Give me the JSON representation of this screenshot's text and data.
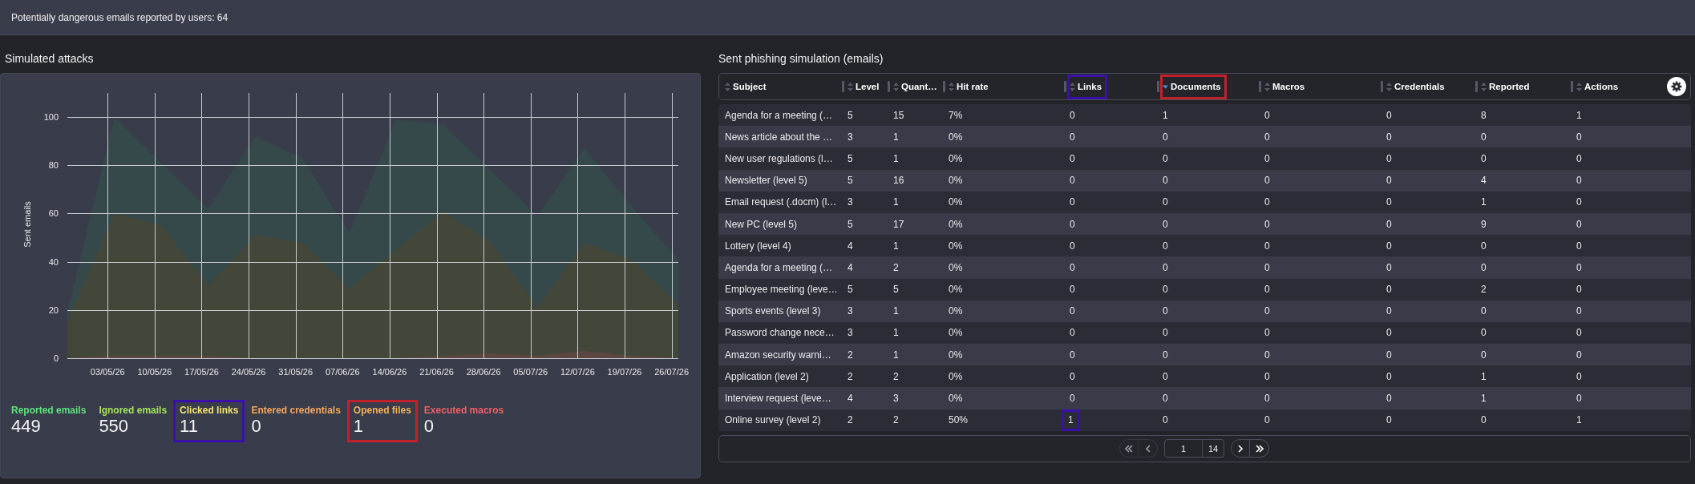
{
  "top_bar": {
    "text": "Potentially dangerous emails reported by users: 64"
  },
  "simulated_attacks": {
    "title": "Simulated attacks",
    "chart_data": {
      "type": "area",
      "ylabel": "Sent emails",
      "grid": true,
      "categories": [
        null,
        "03/05/26",
        "10/05/26",
        "17/05/26",
        "24/05/26",
        "31/05/26",
        "07/06/26",
        "14/06/26",
        "21/06/26",
        "28/06/26",
        "05/07/26",
        "12/07/26",
        "19/07/26",
        "26/07/26"
      ],
      "ylim": [
        0,
        110
      ],
      "yticks": [
        0,
        20,
        40,
        60,
        80,
        100
      ],
      "series": [
        {
          "color": "#35494a",
          "values": [
            19,
            100,
            81,
            62,
            92,
            83,
            52,
            99,
            97,
            78,
            59,
            87,
            63,
            41
          ]
        },
        {
          "color": "#434739",
          "values": [
            15,
            60,
            55,
            30,
            51,
            48,
            29,
            45,
            61,
            48,
            21,
            48,
            41,
            22
          ]
        },
        {
          "color": "#5b4641",
          "values": [
            0,
            1,
            1,
            1,
            0,
            0,
            0,
            0,
            1,
            2,
            1,
            3,
            1,
            0
          ]
        }
      ]
    },
    "stats": [
      {
        "label": "Reported emails",
        "value": "449",
        "color": "#5ee27f"
      },
      {
        "label": "Ignored emails",
        "value": "550",
        "color": "#a2e35b"
      },
      {
        "label": "Clicked links",
        "value": "11",
        "color": "#f3e36b",
        "highlight": {
          "color": "#3b10a8"
        }
      },
      {
        "label": "Entered credentials",
        "value": "0",
        "color": "#f6a75e"
      },
      {
        "label": "Opened files",
        "value": "1",
        "color": "#f4b257",
        "highlight": {
          "color": "#c2212a"
        }
      },
      {
        "label": "Executed macros",
        "value": "0",
        "color": "#f25f66"
      }
    ]
  },
  "phishing_table": {
    "title": "Sent phishing simulation (emails)",
    "columns": [
      {
        "label": "Subject",
        "sorted": false
      },
      {
        "label": "Level",
        "sorted": false
      },
      {
        "label": "Quant…",
        "sorted": false
      },
      {
        "label": "Hit rate",
        "sorted": false
      },
      {
        "label": "Links",
        "sorted": false,
        "highlight": {
          "color": "#3b10a8"
        }
      },
      {
        "label": "Documents",
        "sorted": true,
        "highlight": {
          "color": "#c2212a"
        }
      },
      {
        "label": "Macros",
        "sorted": false
      },
      {
        "label": "Credentials",
        "sorted": false
      },
      {
        "label": "Reported",
        "sorted": false
      },
      {
        "label": "Actions",
        "sorted": false
      }
    ],
    "rows": [
      {
        "cells": [
          "Agenda for a meeting (…",
          "5",
          "15",
          "7%",
          "0",
          "1",
          "0",
          "0",
          "8",
          "1"
        ]
      },
      {
        "cells": [
          "News article about the …",
          "3",
          "1",
          "0%",
          "0",
          "0",
          "0",
          "0",
          "0",
          "0"
        ]
      },
      {
        "cells": [
          "New user regulations (l…",
          "5",
          "1",
          "0%",
          "0",
          "0",
          "0",
          "0",
          "0",
          "0"
        ]
      },
      {
        "cells": [
          "Newsletter (level 5)",
          "5",
          "16",
          "0%",
          "0",
          "0",
          "0",
          "0",
          "4",
          "0"
        ]
      },
      {
        "cells": [
          "Email request (.docm) (l…",
          "3",
          "1",
          "0%",
          "0",
          "0",
          "0",
          "0",
          "1",
          "0"
        ]
      },
      {
        "cells": [
          "New PC (level 5)",
          "5",
          "17",
          "0%",
          "0",
          "0",
          "0",
          "0",
          "9",
          "0"
        ]
      },
      {
        "cells": [
          "Lottery (level 4)",
          "4",
          "1",
          "0%",
          "0",
          "0",
          "0",
          "0",
          "0",
          "0"
        ]
      },
      {
        "cells": [
          "Agenda for a meeting (…",
          "4",
          "2",
          "0%",
          "0",
          "0",
          "0",
          "0",
          "0",
          "0"
        ]
      },
      {
        "cells": [
          "Employee meeting (leve…",
          "5",
          "5",
          "0%",
          "0",
          "0",
          "0",
          "0",
          "2",
          "0"
        ]
      },
      {
        "cells": [
          "Sports events (level 3)",
          "3",
          "1",
          "0%",
          "0",
          "0",
          "0",
          "0",
          "0",
          "0"
        ]
      },
      {
        "cells": [
          "Password change nece…",
          "3",
          "1",
          "0%",
          "0",
          "0",
          "0",
          "0",
          "0",
          "0"
        ]
      },
      {
        "cells": [
          "Amazon security warni…",
          "2",
          "1",
          "0%",
          "0",
          "0",
          "0",
          "0",
          "0",
          "0"
        ]
      },
      {
        "cells": [
          "Application (level 2)",
          "2",
          "2",
          "0%",
          "0",
          "0",
          "0",
          "0",
          "1",
          "0"
        ]
      },
      {
        "cells": [
          "Interview request (leve…",
          "4",
          "3",
          "0%",
          "0",
          "0",
          "0",
          "0",
          "1",
          "0"
        ]
      },
      {
        "cells": [
          "Online survey (level 2)",
          "2",
          "2",
          "50%",
          {
            "text": "1",
            "highlight": {
              "color": "#3b10a8"
            }
          },
          "0",
          "0",
          "0",
          "0",
          "1"
        ]
      }
    ],
    "pagination": {
      "first": {
        "disabled": true
      },
      "previous": {
        "disabled": true
      },
      "page": "1",
      "page_count": "14",
      "next": {
        "disabled": false
      },
      "last": {
        "disabled": false
      }
    }
  }
}
